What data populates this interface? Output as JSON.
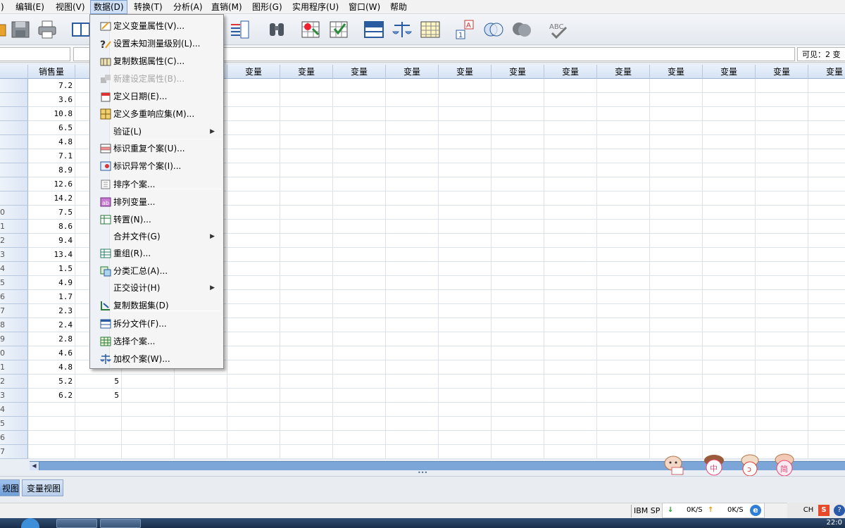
{
  "menubar": {
    "items": [
      {
        "label": ")"
      },
      {
        "label": "编辑(E)"
      },
      {
        "label": "视图(V)"
      },
      {
        "label": "数据(D)"
      },
      {
        "label": "转换(T)"
      },
      {
        "label": "分析(A)"
      },
      {
        "label": "直销(M)"
      },
      {
        "label": "图形(G)"
      },
      {
        "label": "实用程序(U)"
      },
      {
        "label": "窗口(W)"
      },
      {
        "label": "帮助"
      }
    ],
    "active_index": 3
  },
  "data_menu": {
    "items": [
      {
        "label": "定义变量属性(V)...",
        "icon": "define-variable-properties-icon",
        "enabled": true,
        "submenu": false
      },
      {
        "label": "设置未知测量级别(L)...",
        "icon": "unknown-measure-level-icon",
        "enabled": true,
        "submenu": false
      },
      {
        "label": "复制数据属性(C)...",
        "icon": "copy-data-properties-icon",
        "enabled": true,
        "submenu": false
      },
      {
        "label": "新建设定属性(B)...",
        "icon": "new-custom-attribute-icon",
        "enabled": false,
        "submenu": false
      },
      {
        "label": "定义日期(E)...",
        "icon": "calendar-icon",
        "enabled": true,
        "submenu": false
      },
      {
        "label": "定义多重响应集(M)...",
        "icon": "multiple-response-icon",
        "enabled": true,
        "submenu": false
      },
      {
        "label": "验证(L)",
        "icon": "",
        "enabled": true,
        "submenu": true
      },
      {
        "label": "标识重复个案(U)...",
        "icon": "duplicate-cases-icon",
        "enabled": true,
        "submenu": false
      },
      {
        "label": "标识异常个案(I)...",
        "icon": "unusual-cases-icon",
        "enabled": true,
        "submenu": false
      },
      {
        "label": "排序个案...",
        "icon": "sort-cases-icon",
        "enabled": true,
        "submenu": false
      },
      {
        "label": "排列变量...",
        "icon": "sort-variables-icon",
        "enabled": true,
        "submenu": false
      },
      {
        "label": "转置(N)...",
        "icon": "transpose-icon",
        "enabled": true,
        "submenu": false
      },
      {
        "label": "合并文件(G)",
        "icon": "",
        "enabled": true,
        "submenu": true
      },
      {
        "label": "重组(R)...",
        "icon": "restructure-icon",
        "enabled": true,
        "submenu": false
      },
      {
        "label": "分类汇总(A)...",
        "icon": "aggregate-icon",
        "enabled": true,
        "submenu": false
      },
      {
        "label": "正交设计(H)",
        "icon": "",
        "enabled": true,
        "submenu": true
      },
      {
        "label": "复制数据集(D)",
        "icon": "copy-dataset-icon",
        "enabled": true,
        "submenu": false
      },
      {
        "label": "拆分文件(F)...",
        "icon": "split-file-icon",
        "enabled": true,
        "submenu": false
      },
      {
        "label": "选择个案...",
        "icon": "select-cases-icon",
        "enabled": true,
        "submenu": false
      },
      {
        "label": "加权个案(W)...",
        "icon": "weight-cases-icon",
        "enabled": true,
        "submenu": false
      }
    ]
  },
  "editor": {
    "visible_label": "可见：2 变"
  },
  "grid": {
    "var1_name": "销售量",
    "empty_var_label": "变量",
    "row_numbers": [
      "",
      "",
      "",
      "",
      "",
      "",
      "",
      "",
      "",
      "0",
      "1",
      "2",
      "3",
      "4",
      "5",
      "6",
      "7",
      "8",
      "9",
      "0",
      "1",
      "2",
      "3",
      "4",
      "5",
      "6",
      "7"
    ],
    "col1": [
      "7.2",
      "3.6",
      "10.8",
      "6.5",
      "4.8",
      "7.1",
      "8.9",
      "12.6",
      "14.2",
      "7.5",
      "8.6",
      "9.4",
      "13.4",
      "1.5",
      "4.9",
      "1.7",
      "2.3",
      "2.4",
      "2.8",
      "4.6",
      "4.8",
      "5.2",
      "6.2"
    ],
    "col2": [
      "",
      "",
      "",
      "",
      "",
      "",
      "",
      "",
      "",
      "",
      "",
      "",
      "",
      "",
      "",
      "",
      "",
      "",
      "",
      "",
      "",
      "5",
      "5"
    ]
  },
  "tabs": {
    "data_view": "视图",
    "variable_view": "变量视图"
  },
  "status": {
    "text": "IBM SP",
    "down_speed": "0K/S",
    "up_speed": "0K/S"
  },
  "tray": {
    "ime": "CH",
    "s_label": "S",
    "help": "?",
    "clock": "22:0"
  },
  "colors": {
    "menu_highlight": "#cfe0f6",
    "header_blue": "#d6e3f4",
    "scrollbar": "#7da6d8"
  }
}
